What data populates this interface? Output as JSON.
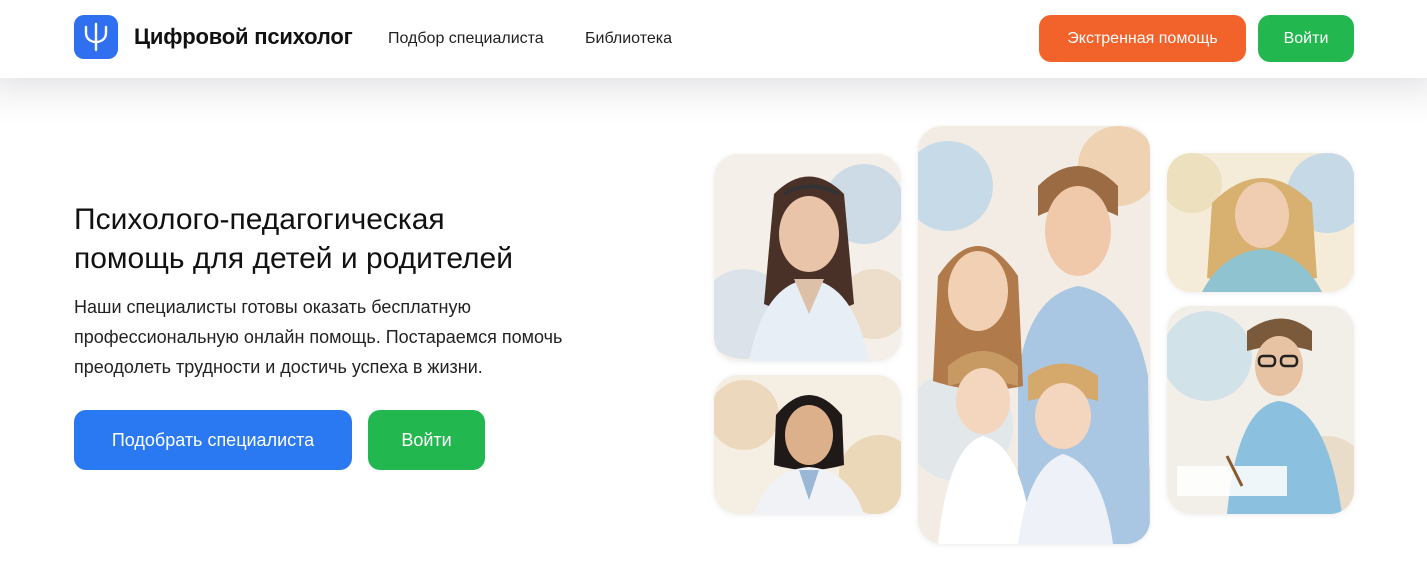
{
  "header": {
    "brand": "Цифровой психолог",
    "nav": [
      "Подбор специалиста",
      "Библиотека"
    ],
    "emergency_label": "Экстренная помощь",
    "login_label": "Войти"
  },
  "hero": {
    "title_line1": "Психолого-педагогическая",
    "title_line2": "помощь для детей и родителей",
    "description_line1": "Наши специалисты готовы оказать бесплатную",
    "description_line2": "профессиональную онлайн помощь. Постараемся помочь",
    "description_line3": "преодолеть трудности и достичь успеха в жизни.",
    "primary_button": "Подобрать специалиста",
    "secondary_button": "Войти"
  },
  "colors": {
    "brand_blue": "#2f6ff0",
    "emergency_orange": "#f2622b",
    "login_green": "#23b84f",
    "primary_blue": "#2a79f3"
  },
  "icons": {
    "logo": "psi-logo-icon"
  },
  "images": [
    "watercolor-portrait-woman-glasses",
    "watercolor-portrait-asian-woman",
    "watercolor-portrait-family",
    "watercolor-portrait-blonde-woman",
    "watercolor-portrait-man-glasses"
  ]
}
